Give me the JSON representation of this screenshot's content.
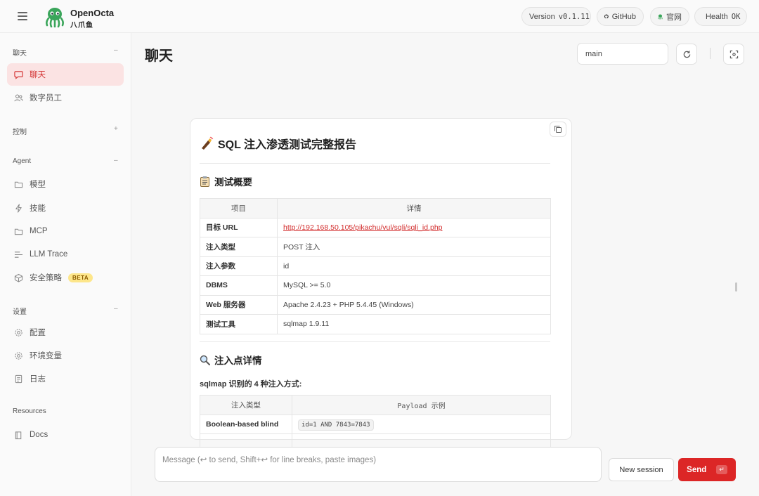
{
  "app": {
    "name": "OpenOcta",
    "subtitle": "八爪鱼"
  },
  "header": {
    "version_label": "Version",
    "version_value": "v0.1.11",
    "github_label": "GitHub",
    "site_label": "官网",
    "health_label": "Health",
    "health_value": "OK",
    "health_color": "#22c55e"
  },
  "sidebar": {
    "sections": [
      {
        "title": "聊天",
        "items": [
          {
            "label": "聊天",
            "icon": "chat-icon",
            "active": true
          },
          {
            "label": "数字员工",
            "icon": "users-icon"
          }
        ]
      },
      {
        "title": "控制",
        "items": []
      },
      {
        "title": "Agent",
        "items": [
          {
            "label": "模型",
            "icon": "folder-icon"
          },
          {
            "label": "技能",
            "icon": "lightning-icon"
          },
          {
            "label": "MCP",
            "icon": "folder-icon"
          },
          {
            "label": "LLM Trace",
            "icon": "trace-icon"
          },
          {
            "label": "安全策略",
            "icon": "cube-icon",
            "badge": "BETA"
          }
        ]
      },
      {
        "title": "设置",
        "items": [
          {
            "label": "配置",
            "icon": "gear-icon"
          },
          {
            "label": "环境变量",
            "icon": "gear-icon"
          },
          {
            "label": "日志",
            "icon": "log-icon"
          }
        ]
      },
      {
        "title": "Resources",
        "items": [
          {
            "label": "Docs",
            "icon": "book-icon"
          }
        ]
      }
    ]
  },
  "main": {
    "title": "聊天",
    "branch": "main"
  },
  "message": {
    "title": "SQL 注入渗透测试完整报告",
    "section1": "测试概要",
    "overview_headers": [
      "项目",
      "详情"
    ],
    "overview_rows": [
      {
        "key": "目标 URL",
        "value": "http://192.168.50.105/pikachu/vul/sqli/sqli_id.php",
        "link": true
      },
      {
        "key": "注入类型",
        "value": "POST 注入"
      },
      {
        "key": "注入参数",
        "value": "id"
      },
      {
        "key": "DBMS",
        "value": "MySQL >= 5.0"
      },
      {
        "key": "Web 服务器",
        "value": "Apache 2.4.23 + PHP 5.4.45 (Windows)"
      },
      {
        "key": "测试工具",
        "value": "sqlmap 1.9.11"
      }
    ],
    "section2": "注入点详情",
    "intro": "sqlmap 识别的 4 种注入方式:",
    "inj_headers": [
      "注入类型",
      "Payload 示例"
    ],
    "inj_rows": [
      {
        "type": "Boolean-based blind",
        "payload": "id=1 AND 7843=7843"
      }
    ]
  },
  "composer": {
    "placeholder": "Message (↩ to send, Shift+↩ for line breaks, paste images)",
    "new_session": "New session",
    "send": "Send",
    "send_key": "↵"
  },
  "colors": {
    "accent": "#dc2626",
    "active_bg": "#fbe3e3",
    "link": "#d32f2f"
  }
}
